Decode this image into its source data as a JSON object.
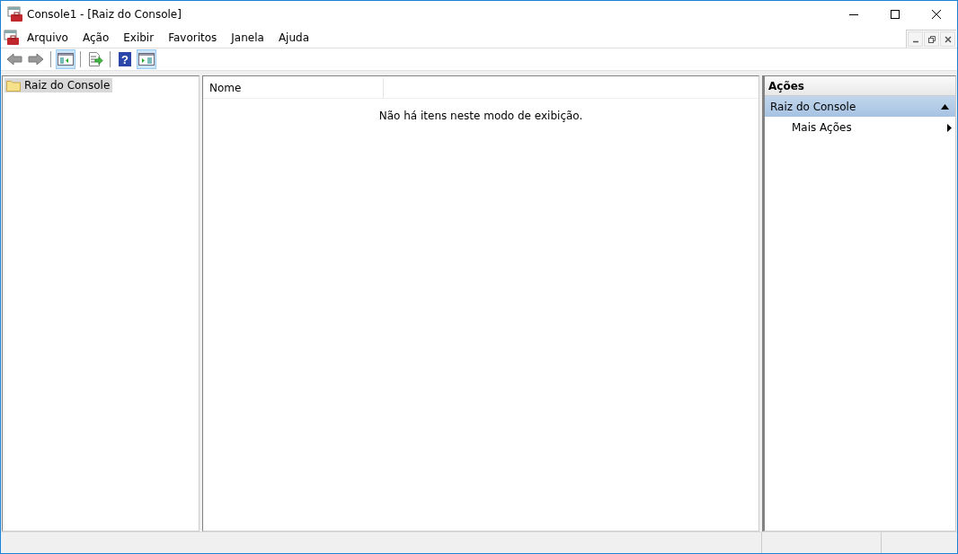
{
  "window": {
    "title": "Console1 - [Raiz do Console]"
  },
  "menu": [
    "Arquivo",
    "Ação",
    "Exibir",
    "Favoritos",
    "Janela",
    "Ajuda"
  ],
  "toolbar": [
    {
      "kind": "back",
      "pressed": false
    },
    {
      "kind": "forward",
      "pressed": false
    },
    {
      "kind": "sep"
    },
    {
      "kind": "tree",
      "pressed": true
    },
    {
      "kind": "sep"
    },
    {
      "kind": "export",
      "pressed": false
    },
    {
      "kind": "sep"
    },
    {
      "kind": "help",
      "pressed": false,
      "glyph": "?"
    },
    {
      "kind": "actions",
      "pressed": true
    }
  ],
  "tree": {
    "items": [
      {
        "label": "Raiz do Console",
        "selected": true
      }
    ]
  },
  "list": {
    "columns": [
      "Nome"
    ],
    "empty_message": "Não há itens neste modo de exibição."
  },
  "actions": {
    "title": "Ações",
    "sections": [
      {
        "label": "Raiz do Console",
        "expanded": true,
        "items": [
          {
            "label": "Mais Ações",
            "submenu": true
          }
        ]
      }
    ]
  }
}
